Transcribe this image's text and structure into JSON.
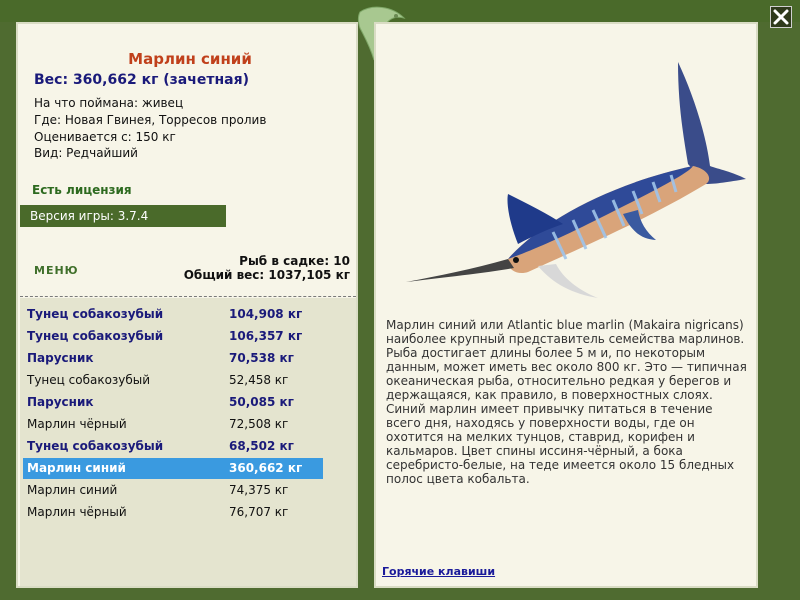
{
  "fish": {
    "title": "Марлин синий",
    "weight_line": "Вес: 360,662 кг (зачетная)",
    "caught_on": "На что поймана: живец",
    "location": "Где: Новая Гвинея, Торресов пролив",
    "rated_from": "Оценивается с: 150 кг",
    "species_type": "Вид: Редчайший"
  },
  "license": "Есть лицензия",
  "version": "Версия игры: 3.7.4",
  "menu_label": "МЕНЮ",
  "stats": {
    "fish_in_cage": "Рыб в садке: 10",
    "total_weight": "Общий вес: 1037,105 кг"
  },
  "catch_list": [
    {
      "name": "Тунец собакозубый",
      "weight": "104,908 кг"
    },
    {
      "name": "Тунец собакозубый",
      "weight": "106,357 кг"
    },
    {
      "name": "Парусник",
      "weight": "70,538 кг"
    },
    {
      "name": "Тунец собакозубый",
      "weight": "52,458 кг"
    },
    {
      "name": "Парусник",
      "weight": "50,085 кг"
    },
    {
      "name": "Марлин чёрный",
      "weight": "72,508 кг"
    },
    {
      "name": "Тунец собакозубый",
      "weight": "68,502 кг"
    },
    {
      "name": "Марлин синий",
      "weight": "360,662 кг"
    },
    {
      "name": "Марлин синий",
      "weight": "74,375 кг"
    },
    {
      "name": "Марлин чёрный",
      "weight": "76,707 кг"
    }
  ],
  "description": "Марлин синий или Atlantic blue marlin (Makaira nigricans) наиболее крупный представитель семейства марлинов. Рыба достигает длины более 5 м и, по некоторым данным, может иметь вес около 800 кг. Это — типичная океаническая рыба, относительно редкая у берегов и держащаяся, как правило, в поверхностных слоях. Синий марлин имеет привычку питаться в течение всего дня, находясь у поверхности воды, где он охотится на мелких тунцов, ставрид, корифен и кальмаров. Цвет спины иссиня-чёрный, а бока серебристо-белые, на теде имеется около 15 бледных полос цвета кобальта.",
  "hotkeys_link": "Горячие клавиши",
  "colors": {
    "frame_green": "#4a6a2a",
    "panel_bg": "#f7f5e8",
    "title_orange": "#c0401b",
    "list_blue": "#1a1a7a",
    "selected_row": "#3a9ae0"
  },
  "icons": {
    "close": "close-icon",
    "decor": "leaping-fish-decoration"
  }
}
